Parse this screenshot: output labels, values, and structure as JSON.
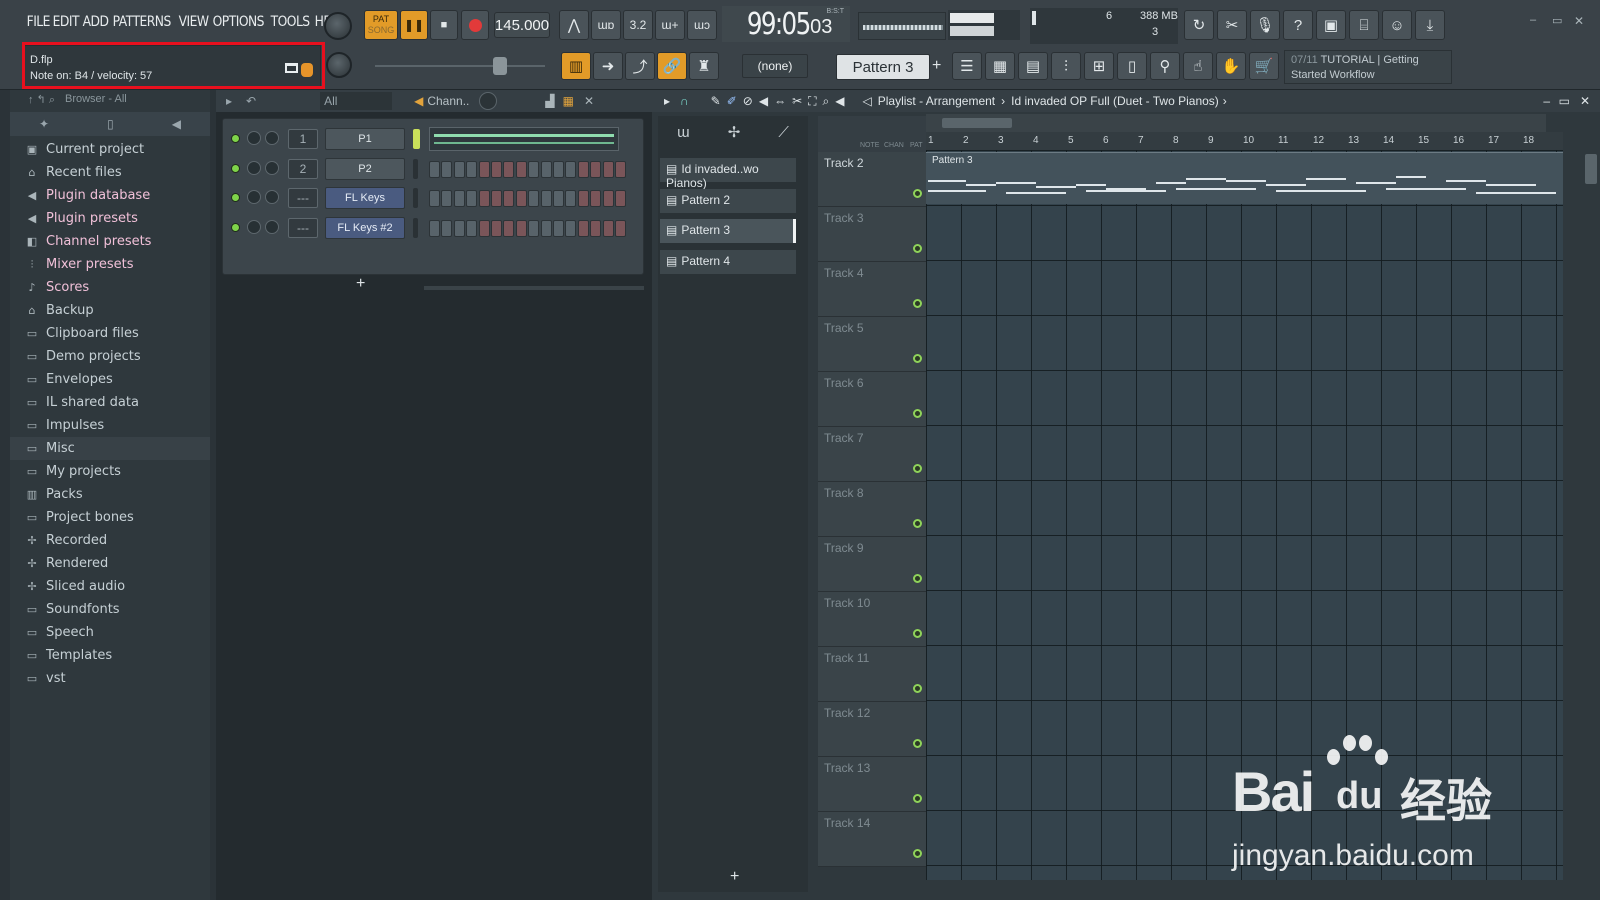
{
  "menu": [
    "FILE",
    "EDIT",
    "ADD",
    "PATTERNS",
    "VIEW",
    "OPTIONS",
    "TOOLS",
    "HELP"
  ],
  "hint": {
    "file": "D.flp",
    "note": "Note on: B4 / velocity: 57"
  },
  "transport": {
    "mode_top": "PAT",
    "mode_bottom": "SONG",
    "tempo": "145.000",
    "time": "99:05",
    "time_ticks": "03",
    "time_label": "B:S:T"
  },
  "cpu": {
    "voices": "6",
    "memory": "388 MB",
    "polyphony": "3"
  },
  "snap": "(none)",
  "pattern_selector": "Pattern 3",
  "news": {
    "counter": "07/11",
    "text": "TUTORIAL | Getting Started Workflow"
  },
  "browser": {
    "header": "Browser - All",
    "items": [
      {
        "label": "Current project",
        "icon": "project-icon"
      },
      {
        "label": "Recent files",
        "icon": "recent-folder-icon"
      },
      {
        "label": "Plugin database",
        "icon": "plugin-icon"
      },
      {
        "label": "Plugin presets",
        "icon": "plugin-preset-icon"
      },
      {
        "label": "Channel presets",
        "icon": "channel-preset-icon"
      },
      {
        "label": "Mixer presets",
        "icon": "mixer-preset-icon"
      },
      {
        "label": "Scores",
        "icon": "note-icon"
      },
      {
        "label": "Backup",
        "icon": "backup-folder-icon"
      },
      {
        "label": "Clipboard files",
        "icon": "folder-icon"
      },
      {
        "label": "Demo projects",
        "icon": "folder-icon"
      },
      {
        "label": "Envelopes",
        "icon": "folder-icon"
      },
      {
        "label": "IL shared data",
        "icon": "folder-icon"
      },
      {
        "label": "Impulses",
        "icon": "folder-icon"
      },
      {
        "label": "Misc",
        "icon": "folder-icon"
      },
      {
        "label": "My projects",
        "icon": "folder-icon"
      },
      {
        "label": "Packs",
        "icon": "packs-icon"
      },
      {
        "label": "Project bones",
        "icon": "folder-icon"
      },
      {
        "label": "Recorded",
        "icon": "recorded-icon"
      },
      {
        "label": "Rendered",
        "icon": "rendered-icon"
      },
      {
        "label": "Sliced audio",
        "icon": "sliced-icon"
      },
      {
        "label": "Soundfonts",
        "icon": "folder-icon"
      },
      {
        "label": "Speech",
        "icon": "folder-icon"
      },
      {
        "label": "Templates",
        "icon": "folder-icon"
      },
      {
        "label": "vst",
        "icon": "folder-icon"
      }
    ]
  },
  "rack": {
    "filter": "All",
    "title": "Chann..",
    "channels": [
      {
        "num": "1",
        "name": "P1"
      },
      {
        "num": "2",
        "name": "P2"
      },
      {
        "num": "---",
        "name": "FL Keys"
      },
      {
        "num": "---",
        "name": "FL Keys #2"
      }
    ],
    "add": "+"
  },
  "playlist": {
    "title": "Playlist - Arrangement",
    "project": "Id invaded OP Full (Duet - Two Pianos)",
    "header_cols": [
      "NOTE",
      "CHAN",
      "PAT"
    ],
    "patterns": [
      "Id invaded..wo Pianos)",
      "Pattern 2",
      "Pattern 3",
      "Pattern 4"
    ],
    "tracks": [
      "Track 2",
      "Track 3",
      "Track 4",
      "Track 5",
      "Track 6",
      "Track 7",
      "Track 8",
      "Track 9",
      "Track 10",
      "Track 11",
      "Track 12",
      "Track 13",
      "Track 14"
    ],
    "ruler": [
      "1",
      "2",
      "3",
      "4",
      "5",
      "6",
      "7",
      "8",
      "9",
      "10",
      "11",
      "12",
      "13",
      "14",
      "15",
      "16",
      "17",
      "18"
    ],
    "clip_label": "Pattern 3",
    "add": "+"
  },
  "watermark": {
    "brand": "Bai",
    "brand2": "du",
    "cn": "经验",
    "url": "jingyan.baidu.com"
  }
}
